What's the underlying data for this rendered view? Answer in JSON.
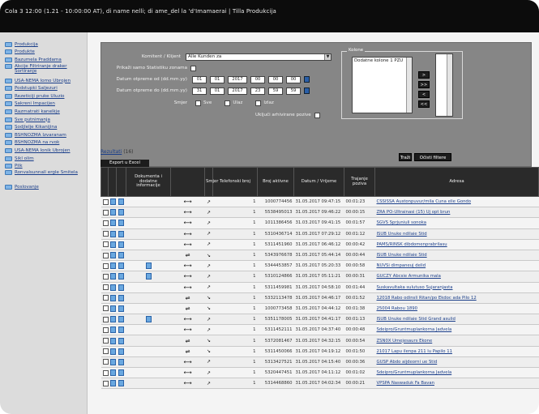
{
  "window_title": "Cola 3 12:00 (1.21 - 10:00:00 AT), di name nelli; di ame_del la 'd'Imamaerai | Tilla Produkcija",
  "sidebar": {
    "items": [
      {
        "label": "Produkcija",
        "multiline": false
      },
      {
        "label": "Produkte",
        "multiline": false
      },
      {
        "label": "Bazumela Praddama",
        "multiline": false
      },
      {
        "label": "Akcije Filtriranje draker Sortiranje",
        "multiline": true
      },
      {
        "label": "USA-NEMA lomo Ubrojen",
        "multiline": false
      },
      {
        "label": "Podstupki Saljezuri",
        "multiline": false
      },
      {
        "label": "Rezeticiji pruke Uluzio",
        "multiline": false
      },
      {
        "label": "Sakreni Impacijen",
        "multiline": false
      },
      {
        "label": "Razmatrati kanelkje",
        "multiline": false
      },
      {
        "label": "Sve putnimanja",
        "multiline": false
      },
      {
        "label": "Sodjlelje Kikanijina",
        "multiline": false
      },
      {
        "label": "BSHNOZMA Izvaranam",
        "multiline": false
      },
      {
        "label": "BSHNOZMA na rvok",
        "multiline": false
      },
      {
        "label": "USA-NEMA lonik Ubrojen",
        "multiline": false
      },
      {
        "label": "Sikl olim",
        "multiline": false
      },
      {
        "label": "Pilk",
        "multiline": false
      },
      {
        "label": "Ronvalsunnall ergle Smitela",
        "multiline": true
      },
      {
        "label": "Poslovanje",
        "multiline": false
      }
    ]
  },
  "filters": {
    "customer_label": "Komitent / Klijent",
    "customer_value": "Alle Kunden za",
    "show_all_label": "Prikaži samo Statistiku zonama",
    "date_from_label": "Datum otpreme od (dd.mm.yy)",
    "date_to_label": "Datum otpreme do (dd.mm.yy)",
    "date_from": [
      "01",
      "01",
      "2017",
      "00",
      "00",
      "00"
    ],
    "date_to": [
      "31",
      "01",
      "2017",
      "23",
      "59",
      "59"
    ],
    "direction_label": "Smjer",
    "direction_options": [
      "Sve",
      "Ulaz",
      "Izlaz"
    ],
    "archive_label": "Uključi arhivirane pozive",
    "columns_legend": "Kolone",
    "columns_selected": "Dodatne kolone 1 PZU",
    "move_buttons": [
      ">",
      ">>",
      "<",
      "<<"
    ],
    "search_button": "Traži",
    "reset_button": "Očisti filtere"
  },
  "results": {
    "label": "Rezultati",
    "count": "(16)",
    "export_button": "Export u Excel"
  },
  "table": {
    "headers": [
      "",
      "",
      "",
      "Dokumenta i dodatne informacije",
      "",
      "Smjer",
      "Telefonski broj",
      "Broj aktivne",
      "Datum / Vrijeme",
      "Trajanje poziva",
      "Adresa"
    ],
    "rows": [
      {
        "tel": "1",
        "acc": "1000774456",
        "dt": "31.05.2017 09:47:15",
        "dur": "00:01:23",
        "addr": "CSSISSA Austonpuvur/mila Cuna elie Gondo",
        "extra": false,
        "hang": false
      },
      {
        "tel": "1",
        "acc": "5538495013",
        "dt": "31.05.2017 09:46:22",
        "dur": "00:00:15",
        "addr": "ZRA PO-Ultrainasi (15) Uj opt brun",
        "extra": false,
        "hang": false
      },
      {
        "tel": "1",
        "acc": "1011386456",
        "dt": "31.03.2017 09:41:15",
        "dur": "00:01:57",
        "addr": "SGVS Sprjuniuli sonoka",
        "extra": false,
        "hang": false
      },
      {
        "tel": "1",
        "acc": "5310436714",
        "dt": "31.05.2017 07:29:12",
        "dur": "00:01:12",
        "addr": "ISUB Unuke ndilaie Stid",
        "extra": false,
        "hang": false
      },
      {
        "tel": "1",
        "acc": "5311451960",
        "dt": "31.05.2017 06:46:12",
        "dur": "00:00:42",
        "addr": "PAMS/RINSK dibdomenprabrilasu",
        "extra": false,
        "hang": false
      },
      {
        "tel": "1",
        "acc": "5343976678",
        "dt": "31.05.2017 05:44:14",
        "dur": "00:00:44",
        "addr": "ISUB Unuke ndilaie Stid",
        "extra": false,
        "hang": true
      },
      {
        "tel": "1",
        "acc": "5344453857",
        "dt": "31.05.2017 05:20:33",
        "dur": "00:00:58",
        "addr": "NUVSi dimpaneuj delid",
        "extra": true,
        "hang": false
      },
      {
        "tel": "1",
        "acc": "5310124866",
        "dt": "31.05.2017 05:11:21",
        "dur": "00:00:31",
        "addr": "GUCZY Abcsie Armunika mala",
        "extra": true,
        "hang": false
      },
      {
        "tel": "1",
        "acc": "5311459981",
        "dt": "31.05.2017 04:58:10",
        "dur": "00:01:44",
        "addr": "Suskavultaka sulutuso Sujaranjasta",
        "extra": false,
        "hang": false
      },
      {
        "tel": "1",
        "acc": "5332113478",
        "dt": "31.05.2017 04:46:17",
        "dur": "00:01:52",
        "addr": "12018 Rabo odinsli Ritan/po Ekdoc ada Pilo 12",
        "extra": false,
        "hang": true
      },
      {
        "tel": "1",
        "acc": "1000773458",
        "dt": "31.05.2017 04:44:12",
        "dur": "00:01:38",
        "addr": "25004 Rabou 1890",
        "extra": false,
        "hang": true
      },
      {
        "tel": "1",
        "acc": "5351178005",
        "dt": "31.05.2017 04:41:17",
        "dur": "00:01:13",
        "addr": "ISUB Unuke ndilaie Stid Grand asulid",
        "extra": true,
        "hang": false
      },
      {
        "tel": "1",
        "acc": "5311452111",
        "dt": "31.05.2017 04:37:40",
        "dur": "00:00:48",
        "addr": "Sdeipro/Gruntmuplankorna Jadvela",
        "extra": false,
        "hang": false
      },
      {
        "tel": "1",
        "acc": "5372081467",
        "dt": "31.05.2017 04:32:15",
        "dur": "00:00:54",
        "addr": "ZSN0X Umejesaurs Ekone",
        "extra": false,
        "hang": true
      },
      {
        "tel": "1",
        "acc": "5311450066",
        "dt": "31.05.2017 04:19:12",
        "dur": "00:01:50",
        "addr": "21017 Lapu ilenpa 211 lu Papilo 11",
        "extra": false,
        "hang": true
      },
      {
        "tel": "1",
        "acc": "5313427521",
        "dt": "31.05.2017 04:15:40",
        "dur": "00:00:36",
        "addr": "GUSP Abdo aijdeorni ue Stid",
        "extra": false,
        "hang": false
      },
      {
        "tel": "1",
        "acc": "5320447451",
        "dt": "31.05.2017 04:11:12",
        "dur": "00:01:02",
        "addr": "Sdeipro/Gruntmuplankorna Jadvela",
        "extra": false,
        "hang": false
      },
      {
        "tel": "1",
        "acc": "5314468860",
        "dt": "31.05.2017 04:02:34",
        "dur": "00:00:21",
        "addr": "VPSPA Naswaduk Fa Bavan",
        "extra": false,
        "hang": false
      }
    ]
  },
  "colors": {
    "topbar": "#0c0c0c",
    "sidebar": "#dcdcdc",
    "filter_panel": "#868686",
    "table_header": "#2a2a2a",
    "link": "#1a3e8a",
    "icon_blue": "#6aa8e0"
  }
}
